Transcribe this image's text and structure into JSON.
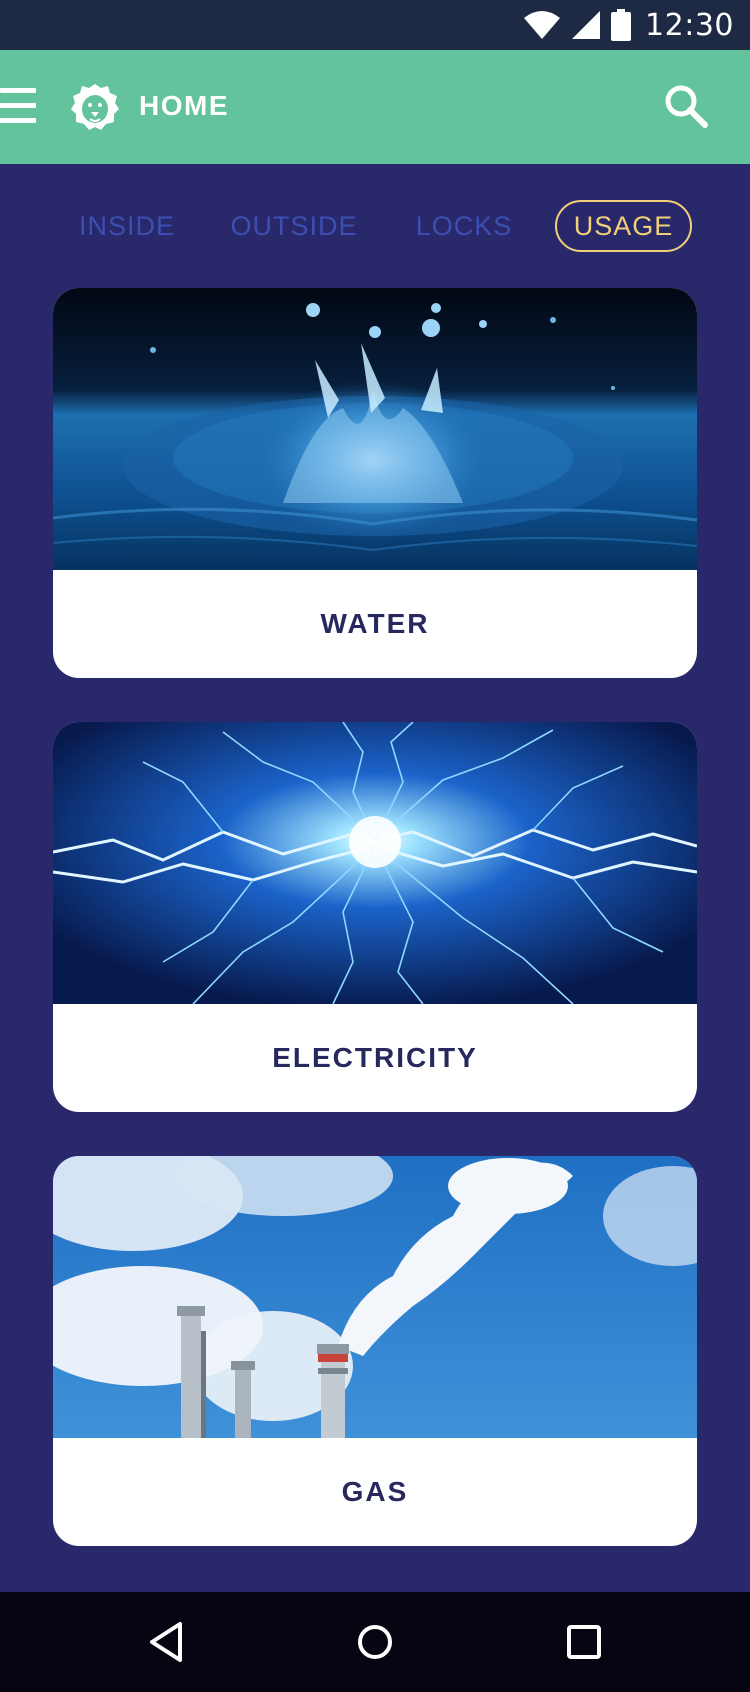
{
  "status_bar": {
    "time": "12:30",
    "icons": [
      "wifi-icon",
      "signal-icon",
      "battery-icon"
    ]
  },
  "app_bar": {
    "title": "HOME",
    "logo_icon": "lion-logo-icon",
    "menu_icon": "hamburger-menu-icon",
    "search_icon": "search-icon",
    "color": "#62c39c"
  },
  "tabs": [
    {
      "label": "INSIDE",
      "active": false
    },
    {
      "label": "OUTSIDE",
      "active": false
    },
    {
      "label": "LOCKS",
      "active": false
    },
    {
      "label": "USAGE",
      "active": true
    }
  ],
  "cards": [
    {
      "label": "WATER",
      "image": "water-splash-image"
    },
    {
      "label": "ELECTRICITY",
      "image": "lightning-image"
    },
    {
      "label": "GAS",
      "image": "smokestack-image"
    }
  ],
  "nav_bar": {
    "icons": [
      "back-icon",
      "home-icon",
      "recents-icon"
    ]
  },
  "colors": {
    "background": "#29286a",
    "tab_inactive": "#3d4eb3",
    "tab_active": "#f2cf7a",
    "card_label": "#26285e"
  }
}
